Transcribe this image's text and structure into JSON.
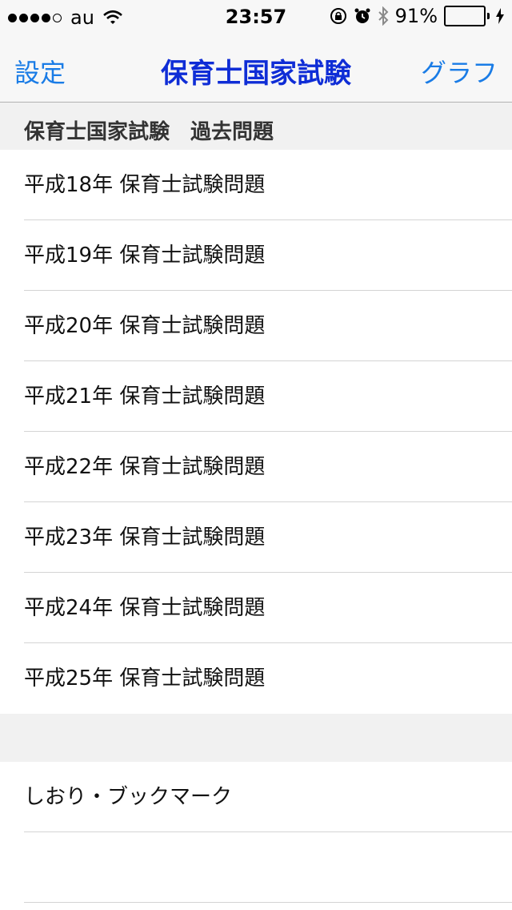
{
  "status_bar": {
    "carrier": "au",
    "time": "23:57",
    "battery_percent": "91%",
    "battery_level": 0.91,
    "signal_strength": 4
  },
  "nav": {
    "left_label": "設定",
    "title": "保育士国家試験",
    "right_label": "グラフ"
  },
  "section": {
    "header": "保育士国家試験　過去問題",
    "items": [
      "平成18年 保育士試験問題",
      "平成19年 保育士試験問題",
      "平成20年 保育士試験問題",
      "平成21年 保育士試験問題",
      "平成22年 保育士試験問題",
      "平成23年 保育士試験問題",
      "平成24年 保育士試験問題",
      "平成25年 保育士試験問題"
    ]
  },
  "second_section": {
    "items": [
      "しおり・ブックマーク",
      ""
    ]
  },
  "colors": {
    "nav_button": "#1a7ce6",
    "nav_title": "#0f2dd6",
    "battery": "#4cd964"
  }
}
